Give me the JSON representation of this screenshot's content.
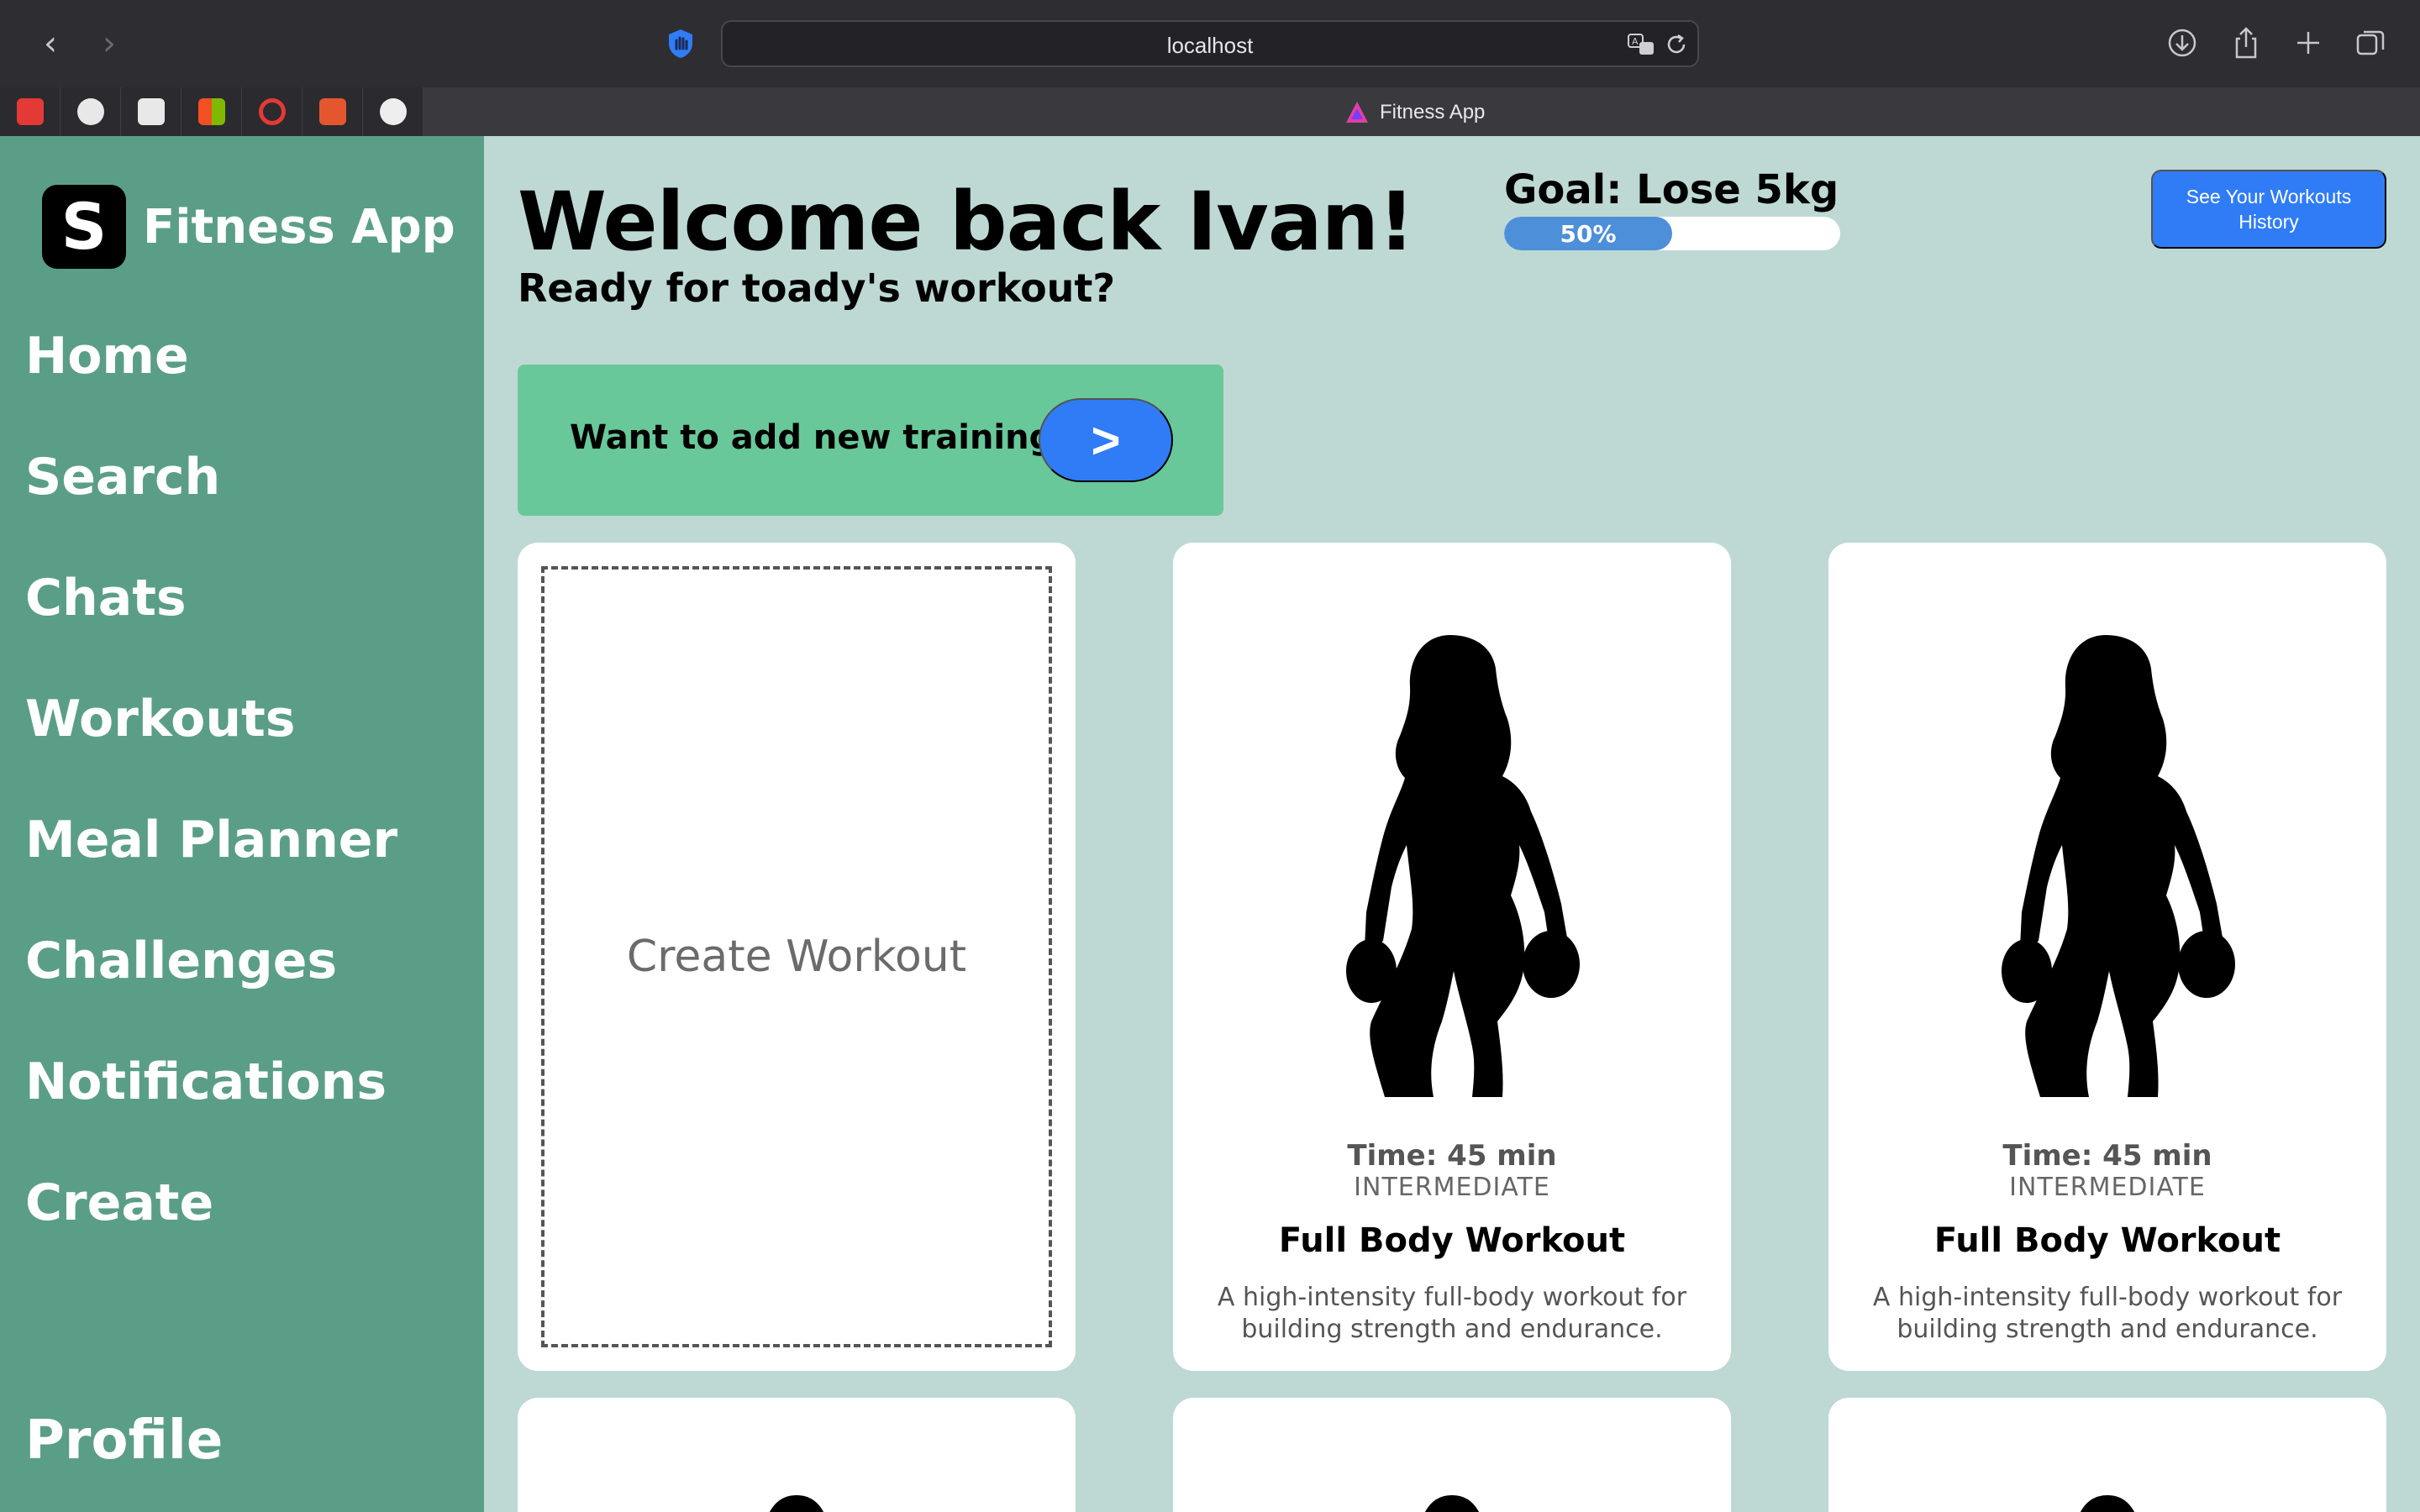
{
  "browser": {
    "url": "localhost",
    "active_tab_title": "Fitness App",
    "favorites": [
      {
        "name": "youtube",
        "color": "#e53935"
      },
      {
        "name": "github",
        "color": "#e8e8e8"
      },
      {
        "name": "gmail",
        "color": "#e8e8e8"
      },
      {
        "name": "microsoft",
        "color": "#7cb342"
      },
      {
        "name": "search",
        "color": "#e53935"
      },
      {
        "name": "figma",
        "color": "#e4572e"
      },
      {
        "name": "extension",
        "color": "#eeeeee"
      }
    ]
  },
  "sidebar": {
    "logo_letter": "S",
    "brand": "Fitness App",
    "items": [
      {
        "label": "Home"
      },
      {
        "label": "Search"
      },
      {
        "label": "Chats"
      },
      {
        "label": "Workouts"
      },
      {
        "label": "Meal Planner"
      },
      {
        "label": "Challenges"
      },
      {
        "label": "Notifications"
      },
      {
        "label": "Create"
      }
    ],
    "profile": "Profile"
  },
  "header": {
    "welcome": "Welcome back Ivan!",
    "subtitle": "Ready for toady's workout?",
    "goal": "Goal: Lose 5kg",
    "progress": 0.5,
    "progress_label": "50%",
    "history_button": "See Your Workouts History"
  },
  "banner": {
    "text": "Want to add new training?",
    "button": ">"
  },
  "create_card": {
    "label": "Create Workout"
  },
  "workouts": [
    {
      "time": "Time: 45 min",
      "level": "INTERMEDIATE",
      "title": "Full Body Workout",
      "description": "A high-intensity full-body workout for building strength and endurance."
    },
    {
      "time": "Time: 45 min",
      "level": "INTERMEDIATE",
      "title": "Full Body Workout",
      "description": "A high-intensity full-body workout for building strength and endurance."
    }
  ],
  "colors": {
    "sidebar": "#5b9e88",
    "background": "#bed9d3",
    "banner": "#68c89a",
    "accent": "#2f7cf6"
  }
}
